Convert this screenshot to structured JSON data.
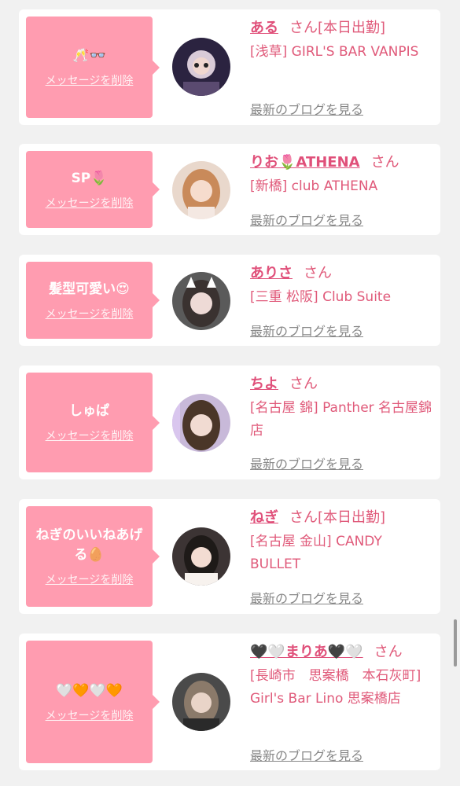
{
  "items": [
    {
      "message": "🥂👓",
      "delete_label": "メッセージを削除",
      "name": "ある",
      "san": "さん",
      "status": "[本日出勤]",
      "shop": "[浅草] GIRL'S BAR VANPIS",
      "blog_link": "最新のブログを見る",
      "avatar_icon": "avatar-icon"
    },
    {
      "message": "SP🌷",
      "delete_label": "メッセージを削除",
      "name": "りお🌷ATHENA",
      "san": "さん",
      "status": "",
      "shop": "[新橋] club ATHENA",
      "blog_link": "最新のブログを見る",
      "avatar_icon": "avatar-icon"
    },
    {
      "message": "髪型可愛い😍",
      "delete_label": "メッセージを削除",
      "name": "ありさ",
      "san": "さん",
      "status": "",
      "shop": "[三重 松阪] Club Suite",
      "blog_link": "最新のブログを見る",
      "avatar_icon": "avatar-icon"
    },
    {
      "message": "しゅぱ",
      "delete_label": "メッセージを削除",
      "name": "ちよ",
      "san": "さん",
      "status": "",
      "shop": "[名古屋 錦] Panther 名古屋錦店",
      "blog_link": "最新のブログを見る",
      "avatar_icon": "avatar-icon"
    },
    {
      "message": "ねぎのいいねあげる🥚",
      "delete_label": "メッセージを削除",
      "name": "ねぎ",
      "san": "さん",
      "status": "[本日出勤]",
      "shop": "[名古屋 金山] CANDY BULLET",
      "blog_link": "最新のブログを見る",
      "avatar_icon": "avatar-icon"
    },
    {
      "message": "🤍🧡🤍🧡",
      "delete_label": "メッセージを削除",
      "name": "🖤🤍まりあ🖤🤍",
      "san": "さん",
      "status": "",
      "shop": "[長崎市　思案橋　本石灰町] Girl's Bar Lino 思案橋店",
      "blog_link": "最新のブログを見る",
      "avatar_icon": "avatar-icon"
    }
  ],
  "colors": {
    "bubble": "#ff9cb0",
    "accent": "#e0507a",
    "link_gray": "#888888",
    "background": "#f1f1f1"
  }
}
